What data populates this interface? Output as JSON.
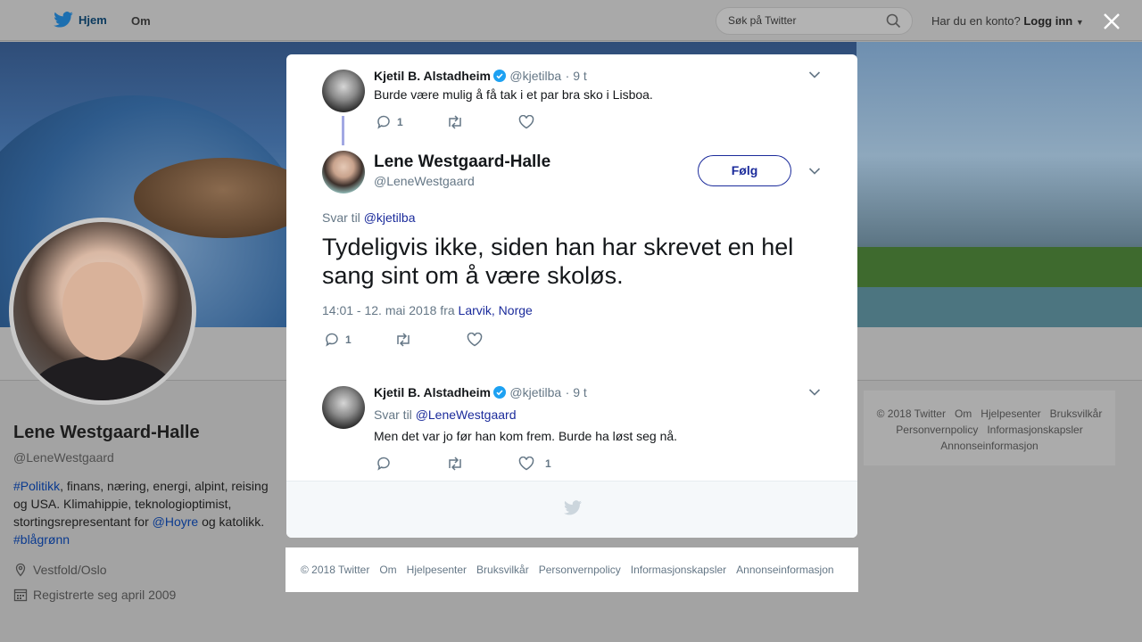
{
  "topnav": {
    "home_label": "Hjem",
    "about_label": "Om",
    "search_placeholder": "Søk på Twitter",
    "account_prompt": "Har du en konto?",
    "login_label": "Logg inn"
  },
  "profile": {
    "name": "Lene Westgaard-Halle",
    "handle": "@LeneWestgaard",
    "bio": {
      "tag1": "#Politikk",
      "text1": ", finans, næring, energi, alpint, reising og USA. Klimahippie, teknologioptimist, stortingsrepresentant for ",
      "mention": "@Hoyre",
      "text2": " og katolikk. ",
      "tag2": "#blågrønn"
    },
    "location": "Vestfold/Oslo",
    "joined": "Registrerte seg april 2009"
  },
  "side_footer": {
    "items": [
      "© 2018 Twitter",
      "Om",
      "Hjelpesenter",
      "Bruksvilkår",
      "Personvernpolicy",
      "Informasjonskapsler",
      "Annonseinformasjon"
    ]
  },
  "modal": {
    "parent_tweet": {
      "name": "Kjetil B. Alstadheim",
      "handle": "@kjetilba",
      "time": "· 9 t",
      "text": "Burde være mulig å få tak i et par bra sko i Lisboa.",
      "reply_count": "1"
    },
    "main_tweet": {
      "name": "Lene Westgaard-Halle",
      "handle": "@LeneWestgaard",
      "follow_label": "Følg",
      "reply_to_prefix": "Svar til",
      "reply_to": "@kjetilba",
      "text": "Tydeligvis ikke, siden han har skrevet en hel sang sint om å være skoløs.",
      "timestamp": "14:01 - 12. mai 2018 fra",
      "place": "Larvik, Norge",
      "reply_count": "1"
    },
    "reply_tweet": {
      "name": "Kjetil B. Alstadheim",
      "handle": "@kjetilba",
      "time": "· 9 t",
      "reply_to_prefix": "Svar til",
      "reply_to": "@LeneWestgaard",
      "text": "Men det var jo før han kom frem. Burde ha løst seg nå.",
      "like_count": "1"
    }
  },
  "modal_footer": {
    "items": [
      "© 2018 Twitter",
      "Om",
      "Hjelpesenter",
      "Bruksvilkår",
      "Personvernpolicy",
      "Informasjonskapsler",
      "Annonseinformasjon"
    ]
  },
  "colors": {
    "link": "#1b2b9b",
    "twitter_blue": "#1da1f2",
    "overlay": "#a3a3a3"
  }
}
